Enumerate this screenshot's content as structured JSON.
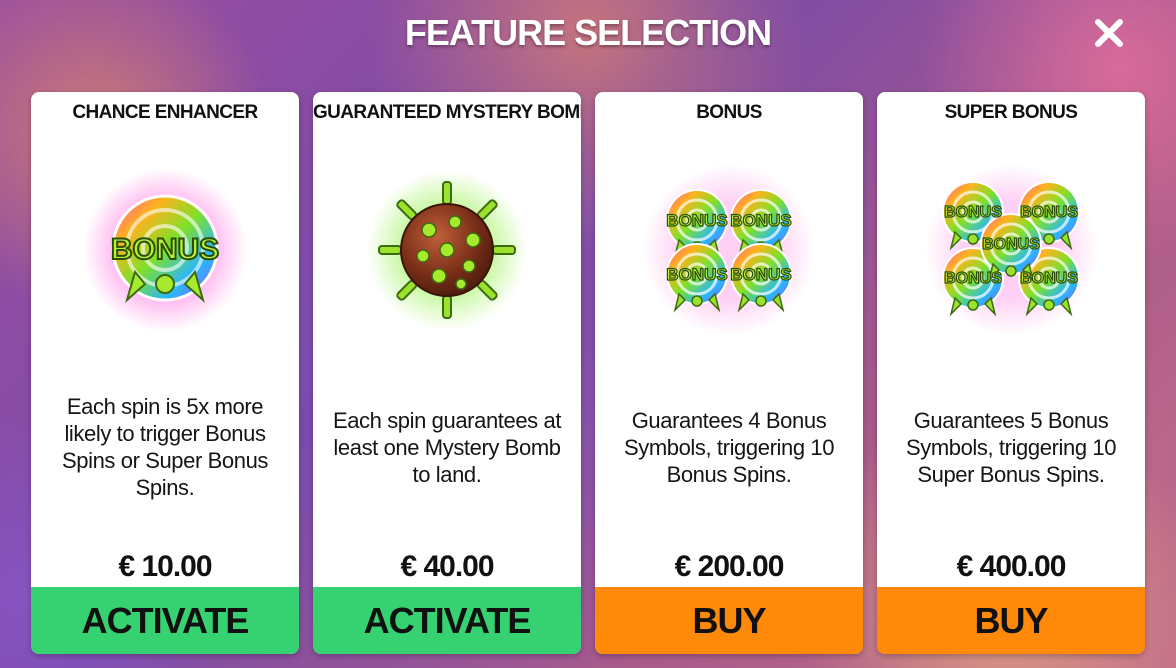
{
  "header": {
    "title": "FEATURE SELECTION",
    "close_icon": "close-icon"
  },
  "colors": {
    "activate_button": "#36d271",
    "buy_button": "#ff8a0a",
    "card_background": "#ffffff",
    "title_text": "#ffffff"
  },
  "cards": [
    {
      "title": "CHANCE ENHANCER",
      "icon": "bonus-lollipop-icon",
      "icon_text": "BONUS",
      "description": "Each spin is 5x more likely to trigger Bonus Spins or Super Bonus Spins.",
      "price": "€ 10.00",
      "button_label": "ACTIVATE"
    },
    {
      "title": "GUARANTEED MYSTERY BOMB",
      "icon": "mystery-bomb-icon",
      "description": "Each spin guarantees at least one Mystery Bomb to land.",
      "price": "€ 40.00",
      "button_label": "ACTIVATE"
    },
    {
      "title": "BONUS",
      "icon": "four-bonus-symbols-icon",
      "icon_text": "BONUS",
      "description": "Guarantees 4 Bonus Symbols, triggering 10 Bonus Spins.",
      "price": "€ 200.00",
      "button_label": "BUY"
    },
    {
      "title": "SUPER BONUS",
      "icon": "five-bonus-symbols-icon",
      "icon_text": "BONUS",
      "description": "Guarantees 5 Bonus Symbols, triggering 10 Super Bonus Spins.",
      "price": "€ 400.00",
      "button_label": "BUY"
    }
  ]
}
